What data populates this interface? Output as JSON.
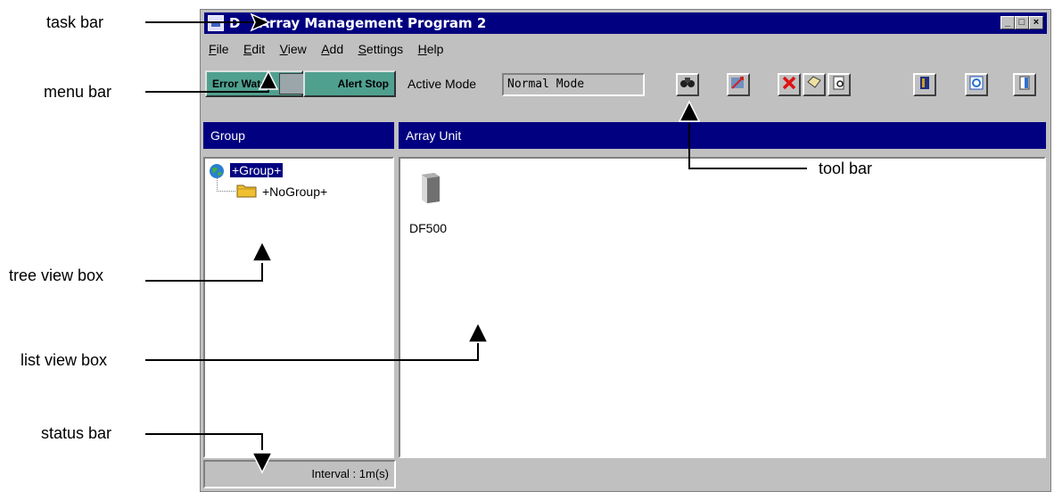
{
  "annotations": {
    "task_bar": "task bar",
    "menu_bar": "menu bar",
    "tree_view_box": "tree view box",
    "list_view_box": "list view box",
    "status_bar": "status bar",
    "tool_bar": "tool bar"
  },
  "window": {
    "title": "Array Management Program 2",
    "title_prefix": "D",
    "minimize_glyph": "_",
    "maximize_glyph": "□",
    "close_glyph": "×"
  },
  "menu": {
    "items": [
      {
        "underlined": "F",
        "rest": "ile"
      },
      {
        "underlined": "E",
        "rest": "dit"
      },
      {
        "underlined": "V",
        "rest": "iew"
      },
      {
        "underlined": "A",
        "rest": "dd"
      },
      {
        "underlined": "S",
        "rest": "ettings"
      },
      {
        "underlined": "H",
        "rest": "elp"
      }
    ]
  },
  "toolbar": {
    "error_watch_label": "Error Watch",
    "alert_stop_label": "Alert Stop",
    "active_mode_label": "Active Mode",
    "active_mode_value": "Normal Mode",
    "icons": [
      "binoculars-icon",
      "transfer-icon",
      "delete-icon",
      "tag-icon",
      "inspect-icon",
      "array-icon",
      "refresh-icon",
      "exit-icon"
    ]
  },
  "tree": {
    "header": "Group",
    "root": "+Group+",
    "child": "+NoGroup+"
  },
  "list": {
    "header": "Array Unit",
    "items": [
      {
        "label": "DF500"
      }
    ]
  },
  "status": {
    "interval": "Interval : 1m(s)"
  }
}
